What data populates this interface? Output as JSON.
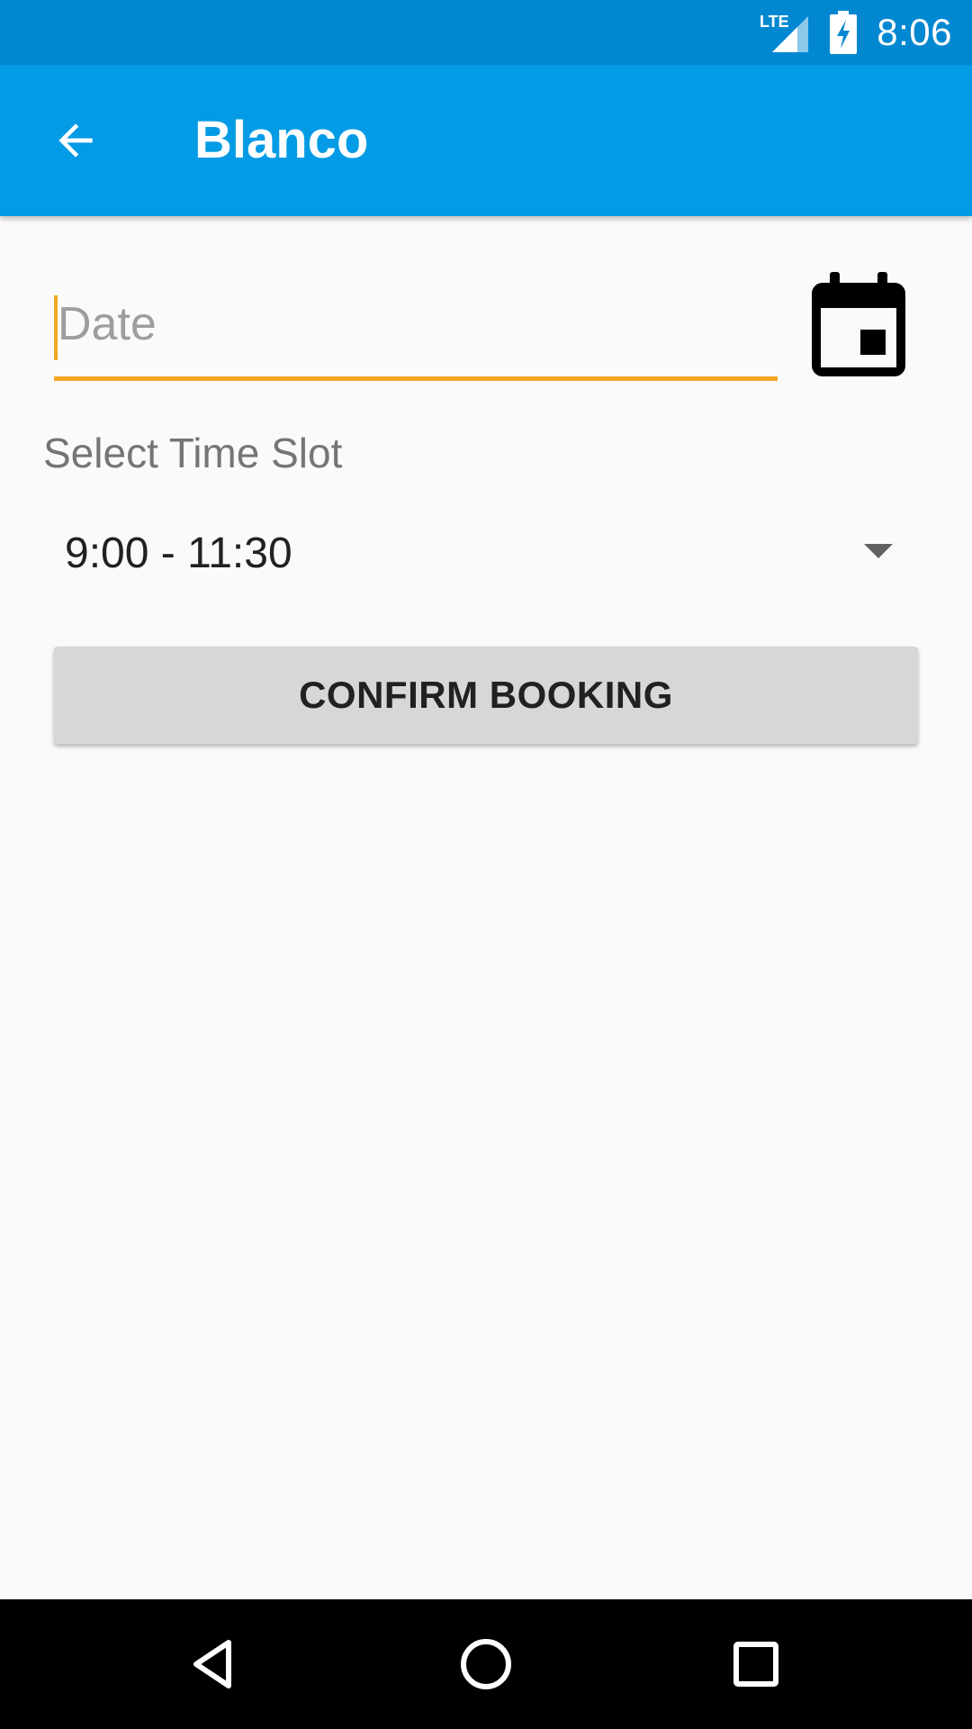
{
  "status_bar": {
    "network": "LTE",
    "time": "8:06",
    "icons": [
      "lte-signal-icon",
      "battery-charging-icon"
    ]
  },
  "app_bar": {
    "title": "Blanco",
    "back_icon": "arrow-back-icon"
  },
  "form": {
    "date": {
      "placeholder": "Date",
      "value": ""
    },
    "calendar_icon": "calendar-icon",
    "time_slot_label": "Select Time Slot",
    "time_slot_selected": "9:00 - 11:30",
    "confirm_label": "CONFIRM BOOKING"
  },
  "nav_bar": {
    "icons": [
      "nav-back-icon",
      "nav-home-icon",
      "nav-recents-icon"
    ]
  },
  "colors": {
    "status_bar": "#0288d1",
    "app_bar": "#039be5",
    "accent": "#f5a623",
    "button": "#d6d7d7",
    "background": "#fafafa"
  }
}
